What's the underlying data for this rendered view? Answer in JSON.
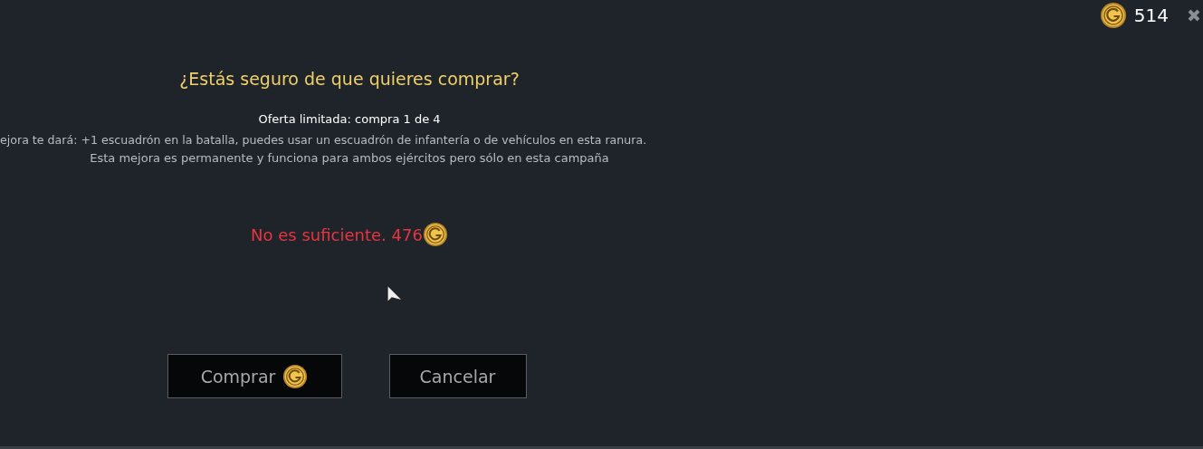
{
  "balance": {
    "amount": "514"
  },
  "dialog": {
    "title": "¿Estás seguro de que quieres comprar?",
    "subtitle": "Oferta limitada: compra 1 de 4",
    "description": [
      "ejora te dará: +1 escuadrón en la batalla, puedes usar un escuadrón de infantería o de vehículos en esta ranura.",
      "Esta mejora es permanente y funciona para ambos ejércitos pero sólo en esta campaña"
    ],
    "warning": "No es suficiente. 476",
    "buttons": [
      {
        "label": "Comprar",
        "kind": "coin"
      },
      {
        "label": "Cancelar",
        "kind": "plain"
      }
    ]
  }
}
